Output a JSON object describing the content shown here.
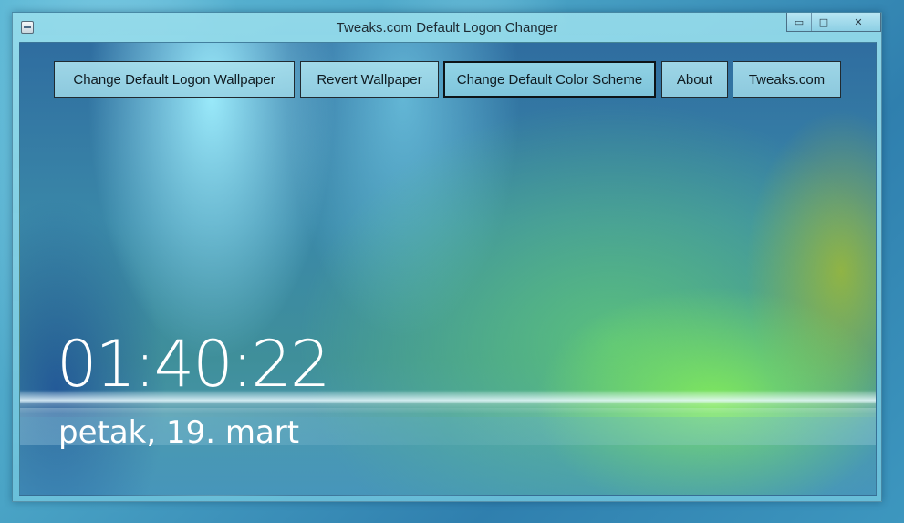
{
  "window": {
    "title": "Tweaks.com Default Logon Changer",
    "controls": {
      "minimize": "▭",
      "maximize": "□",
      "close": "✕"
    }
  },
  "toolbar": {
    "buttons": [
      {
        "label": "Change Default Logon Wallpaper"
      },
      {
        "label": "Revert Wallpaper"
      },
      {
        "label": "Change Default Color Scheme",
        "active": true
      },
      {
        "label": "About"
      },
      {
        "label": "Tweaks.com"
      }
    ]
  },
  "preview": {
    "time": "01:40:22",
    "date": "petak, 19. mart"
  },
  "icons": {
    "app": "app-icon"
  }
}
